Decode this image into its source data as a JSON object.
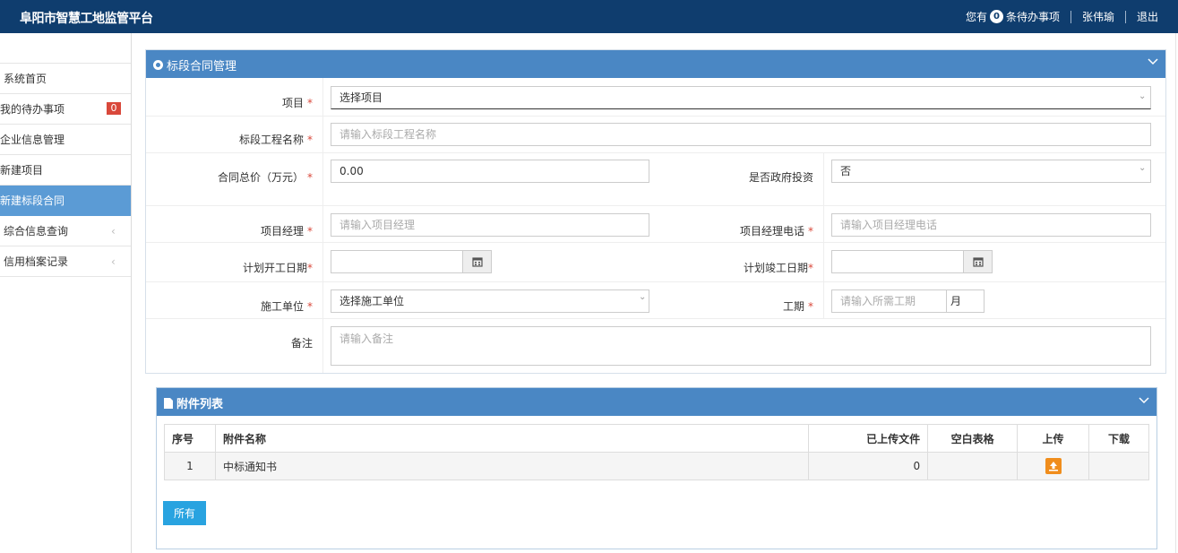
{
  "header": {
    "app_title": "阜阳市智慧工地监管平台",
    "todo_prefix": "您有",
    "todo_count": "0",
    "todo_suffix": "条待办事项",
    "user_name": "张伟瑜",
    "logout": "退出"
  },
  "sidebar": {
    "items": [
      {
        "label": "系统首页"
      },
      {
        "label": "我的待办事项",
        "badge": "0"
      },
      {
        "label": "企业信息管理"
      },
      {
        "label": "新建项目"
      },
      {
        "label": "新建标段合同",
        "active": true
      },
      {
        "label": "综合信息查询",
        "chevron": "‹"
      },
      {
        "label": "信用档案记录",
        "chevron": "‹"
      }
    ]
  },
  "panel": {
    "title": "标段合同管理",
    "fields": {
      "project": {
        "label": "项目",
        "value": "选择项目"
      },
      "section_name": {
        "label": "标段工程名称",
        "placeholder": "请输入标段工程名称"
      },
      "contract_price": {
        "label": "合同总价（万元）",
        "value": "0.00"
      },
      "gov_invest": {
        "label": "是否政府投资",
        "value": "否"
      },
      "project_manager": {
        "label": "项目经理",
        "placeholder": "请输入项目经理"
      },
      "manager_phone": {
        "label": "项目经理电话",
        "placeholder": "请输入项目经理电话"
      },
      "plan_start": {
        "label": "计划开工日期"
      },
      "plan_end": {
        "label": "计划竣工日期"
      },
      "contractor": {
        "label": "施工单位",
        "value": "选择施工单位"
      },
      "duration": {
        "label": "工期",
        "placeholder": "请输入所需工期",
        "unit": "月"
      },
      "remark": {
        "label": "备注",
        "placeholder": "请输入备注"
      }
    },
    "required_mark": "*"
  },
  "attachments": {
    "title": "附件列表",
    "columns": [
      "序号",
      "附件名称",
      "已上传文件",
      "空白表格",
      "上传",
      "下载"
    ],
    "rows": [
      {
        "index": "1",
        "name": "中标通知书",
        "uploaded": "0",
        "blank": "",
        "download": ""
      }
    ],
    "all_button": "所有"
  },
  "colors": {
    "topbar": "#0f3d6e",
    "panel_header": "#4a87c4",
    "active_menu": "#5b9bd5",
    "badge": "#d9483b",
    "upload": "#f08d1c",
    "button": "#29a3e0"
  }
}
